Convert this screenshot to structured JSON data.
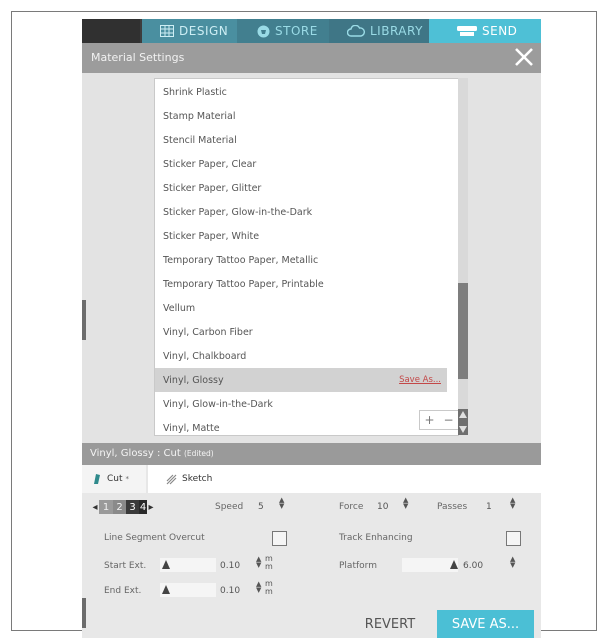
{
  "nav": {
    "tabs": [
      {
        "label": "DESIGN",
        "icon": "grid-icon"
      },
      {
        "label": "STORE",
        "icon": "store-icon"
      },
      {
        "label": "LIBRARY",
        "icon": "cloud-icon"
      },
      {
        "label": "SEND",
        "icon": "cutter-icon"
      }
    ]
  },
  "dialog": {
    "title": "Material Settings",
    "close_icon": "close-icon"
  },
  "materials": {
    "items": [
      "Shrink Plastic",
      "Stamp Material",
      "Stencil Material",
      "Sticker Paper, Clear",
      "Sticker Paper, Glitter",
      "Sticker Paper, Glow-in-the-Dark",
      "Sticker Paper, White",
      "Temporary Tattoo Paper, Metallic",
      "Temporary Tattoo Paper, Printable",
      "Vellum",
      "Vinyl, Carbon Fiber",
      "Vinyl, Chalkboard",
      "Vinyl, Glossy",
      "Vinyl, Glow-in-the-Dark",
      "Vinyl, Matte"
    ],
    "selected": "Vinyl, Glossy",
    "save_as_link": "Save As...",
    "add_symbol": "+",
    "remove_symbol": "−"
  },
  "status": {
    "text": "Vinyl, Glossy : Cut",
    "edited": "(Edited)"
  },
  "tabs": {
    "cut": "Cut",
    "cut_mark": "*",
    "sketch": "Sketch"
  },
  "settings": {
    "tool_sequence": [
      "1",
      "2",
      "3",
      "4"
    ],
    "speed_label": "Speed",
    "speed_value": "5",
    "force_label": "Force",
    "force_value": "10",
    "passes_label": "Passes",
    "passes_value": "1",
    "line_segment_label": "Line Segment Overcut",
    "track_label": "Track Enhancing",
    "start_ext_label": "Start Ext.",
    "start_ext_value": "0.10",
    "end_ext_label": "End Ext.",
    "end_ext_value": "0.10",
    "platform_label": "Platform",
    "platform_value": "6.00",
    "unit_m1": "m",
    "unit_m2": "m"
  },
  "buttons": {
    "revert": "REVERT",
    "save_as": "SAVE AS..."
  },
  "colors": {
    "accent": "#4ec0d6",
    "save_link": "#c34848"
  }
}
